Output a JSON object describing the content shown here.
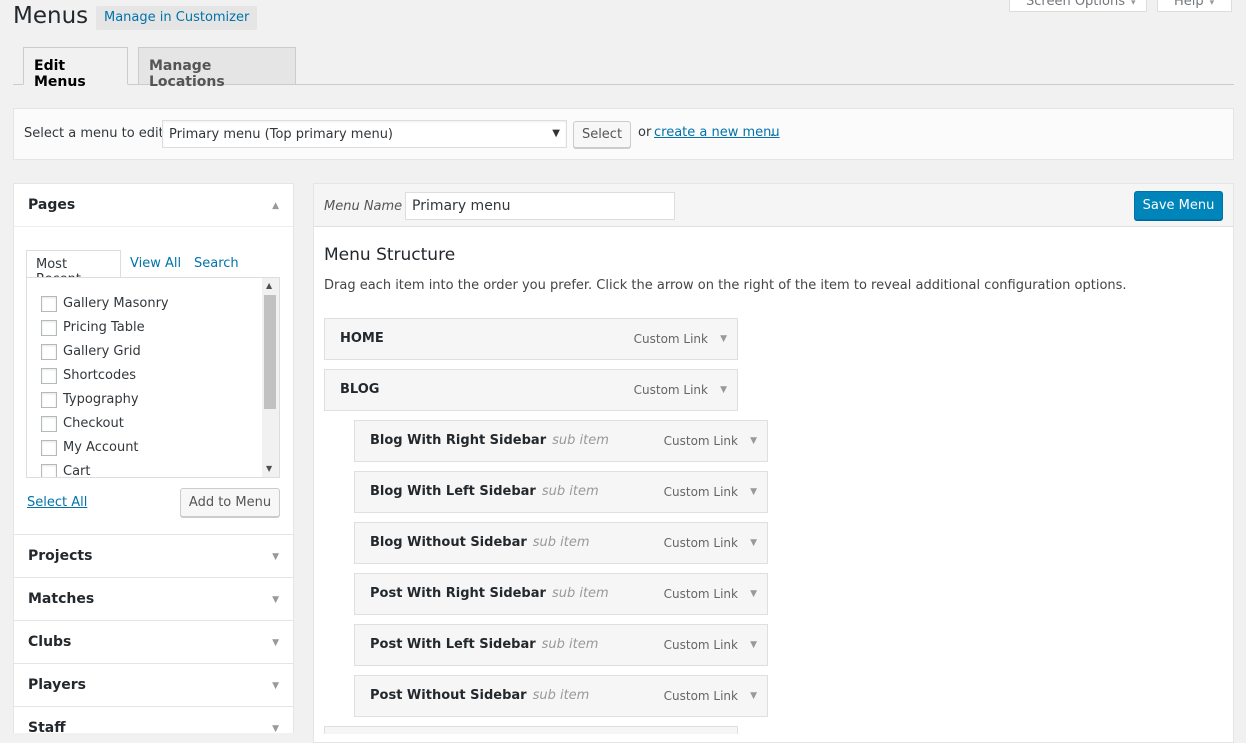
{
  "header": {
    "title": "Menus",
    "customizer_button": "Manage in Customizer",
    "screen_options": "Screen Options",
    "help": "Help"
  },
  "nav_tabs": [
    {
      "label": "Edit Menus",
      "active": true
    },
    {
      "label": "Manage Locations",
      "active": false
    }
  ],
  "manage_bar": {
    "label": "Select a menu to edit:",
    "selected_menu": "Primary menu (Top primary menu)",
    "select_button": "Select",
    "or_text": "or",
    "create_link": "create a new menu",
    "period": "."
  },
  "pages_panel": {
    "title": "Pages",
    "tabs": [
      "Most Recent",
      "View All",
      "Search"
    ],
    "items": [
      "Gallery Masonry",
      "Pricing Table",
      "Gallery Grid",
      "Shortcodes",
      "Typography",
      "Checkout",
      "My Account",
      "Cart"
    ],
    "select_all": "Select All",
    "add_button": "Add to Menu"
  },
  "accordion_sections": [
    "Projects",
    "Matches",
    "Clubs",
    "Players",
    "Staff"
  ],
  "menu_editor": {
    "name_label": "Menu Name",
    "name_value": "Primary menu",
    "save_button": "Save Menu",
    "structure_title": "Menu Structure",
    "structure_desc": "Drag each item into the order you prefer. Click the arrow on the right of the item to reveal additional configuration options.",
    "items": [
      {
        "title": "HOME",
        "sub": "",
        "type": "Custom Link",
        "depth": 0
      },
      {
        "title": "BLOG",
        "sub": "",
        "type": "Custom Link",
        "depth": 0
      },
      {
        "title": "Blog With Right Sidebar",
        "sub": "sub item",
        "type": "Custom Link",
        "depth": 1
      },
      {
        "title": "Blog With Left Sidebar",
        "sub": "sub item",
        "type": "Custom Link",
        "depth": 1
      },
      {
        "title": "Blog Without Sidebar",
        "sub": "sub item",
        "type": "Custom Link",
        "depth": 1
      },
      {
        "title": "Post With Right Sidebar",
        "sub": "sub item",
        "type": "Custom Link",
        "depth": 1
      },
      {
        "title": "Post With Left Sidebar",
        "sub": "sub item",
        "type": "Custom Link",
        "depth": 1
      },
      {
        "title": "Post Without Sidebar",
        "sub": "sub item",
        "type": "Custom Link",
        "depth": 1
      }
    ]
  }
}
